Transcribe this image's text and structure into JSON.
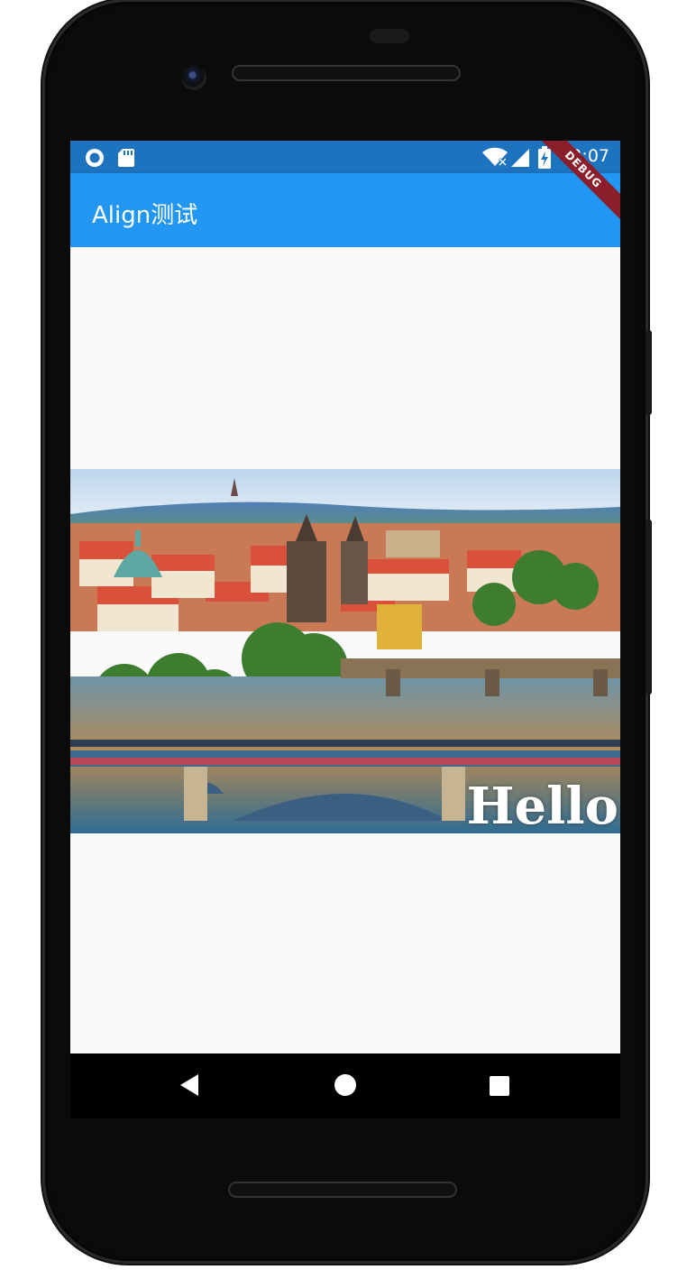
{
  "status_bar": {
    "time": "12:07",
    "left_icons": [
      "record-icon",
      "sd-card-icon"
    ],
    "right_icons": [
      "wifi-icon",
      "signal-icon",
      "battery-charging-icon"
    ]
  },
  "debug_banner": "DEBUG",
  "app_bar": {
    "title": "Align测试"
  },
  "content": {
    "overlay_text": "Hello",
    "image_icon": "city-river-bridge-photo"
  },
  "nav_bar": {
    "icons": [
      "back-icon",
      "home-icon",
      "recents-icon"
    ]
  },
  "colors": {
    "status_bar": "#1e73bf",
    "app_bar": "#2196f3",
    "debug_banner": "#8b1e2b",
    "background": "#fafafa"
  }
}
